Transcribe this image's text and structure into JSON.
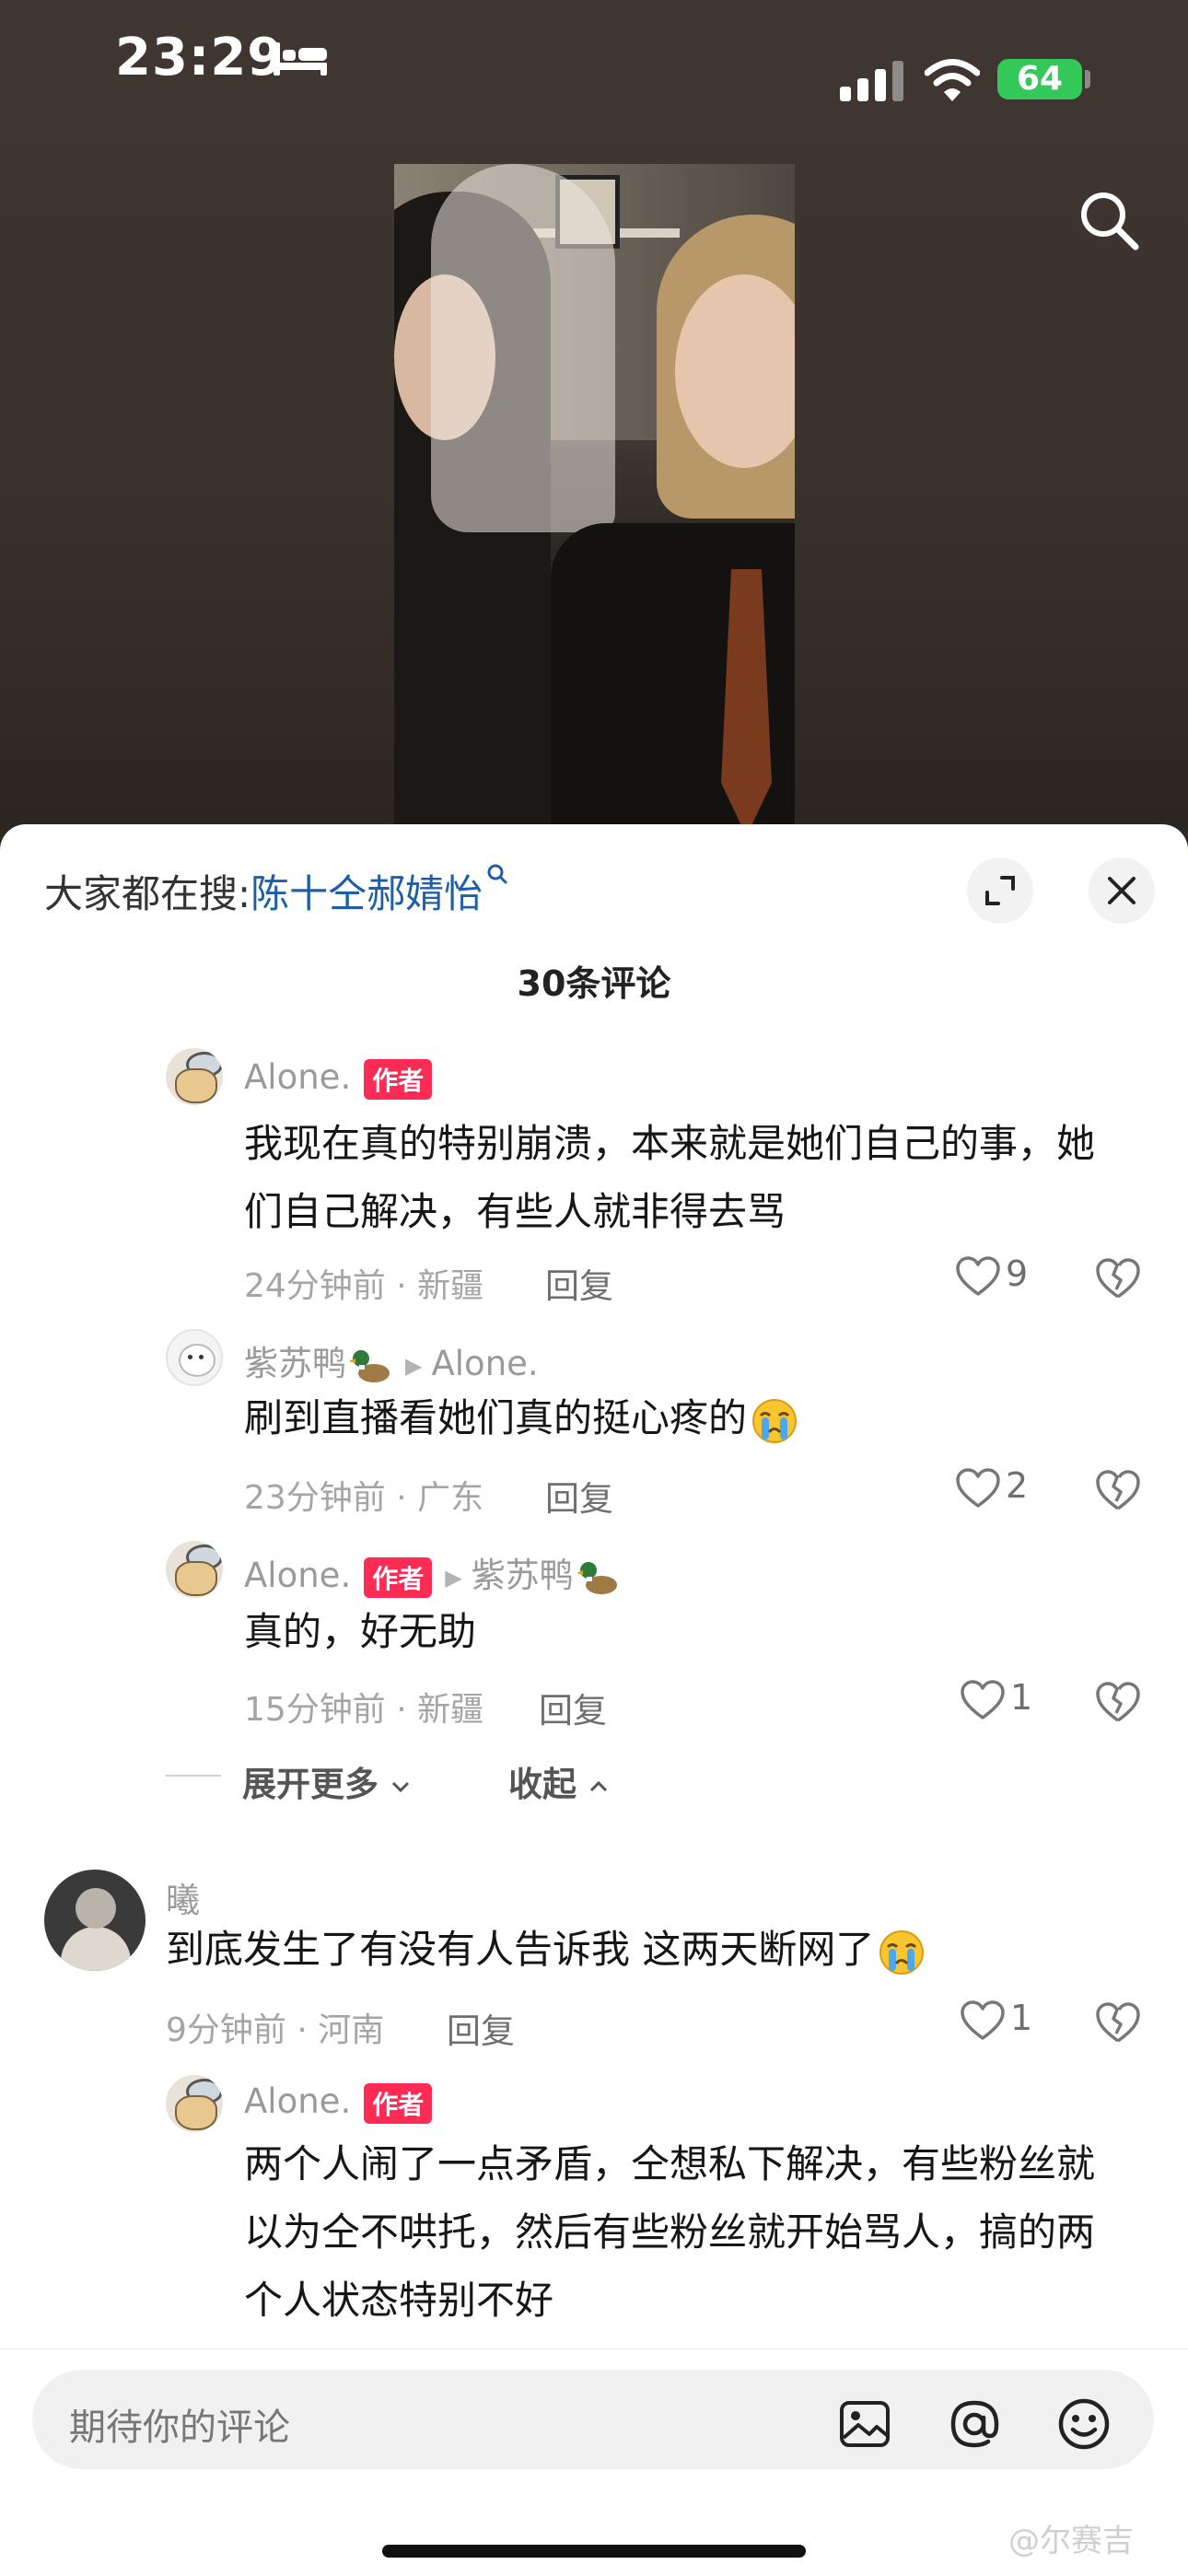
{
  "status_bar": {
    "time": "23:29",
    "battery": "64"
  },
  "search_hint": {
    "prefix": "大家都在搜:",
    "keyword": "陈十仝郝婧怡"
  },
  "comments_header": {
    "count_label": "30条评论"
  },
  "comments": [
    {
      "user": "Alone.",
      "badge": "作者",
      "lines": [
        "我现在真的特别崩溃，本来就是她们自己的事，她",
        "们自己解决，有些人就非得去骂"
      ],
      "meta": "24分钟前 · 新疆",
      "reply": "回复",
      "likes": "9"
    },
    {
      "user": "紫苏鸭",
      "reply_to": "Alone.",
      "lines": [
        "刷到直播看她们真的挺心疼的"
      ],
      "meta": "23分钟前 · 广东",
      "reply": "回复",
      "likes": "2"
    },
    {
      "user": "Alone.",
      "badge": "作者",
      "reply_to": "紫苏鸭",
      "lines": [
        "真的，好无助"
      ],
      "meta": "15分钟前 · 新疆",
      "reply": "回复",
      "likes": "1"
    },
    {
      "user": "曦",
      "lines": [
        "到底发生了有没有人告诉我  这两天断网了"
      ],
      "meta": "9分钟前 · 河南",
      "reply": "回复",
      "likes": "1"
    },
    {
      "user": "Alone.",
      "badge": "作者",
      "lines": [
        "两个人闹了一点矛盾，仝想私下解决，有些粉丝就",
        "以为仝不哄托，然后有些粉丝就开始骂人，搞的两",
        "个人状态特别不好"
      ]
    }
  ],
  "thread_controls": {
    "expand": "展开更多",
    "collapse": "收起"
  },
  "input_bar": {
    "placeholder": "期待你的评论"
  },
  "watermark": "@尔赛吉",
  "icons": {
    "status": [
      "bed-icon",
      "signal-icon",
      "wifi-icon"
    ],
    "actions": [
      "search-icon",
      "expand-icon",
      "close-icon",
      "heart-icon",
      "dislike-icon",
      "image-icon",
      "at-icon",
      "emoji-icon"
    ]
  },
  "colors": {
    "author_badge": "#fe2c55",
    "search_keyword": "#1f5fa8",
    "battery": "#34c759"
  }
}
